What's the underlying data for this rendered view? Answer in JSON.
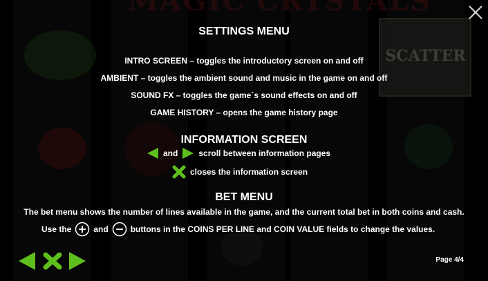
{
  "background": {
    "title_text": "MAGIC CRYSTALS",
    "scatter_text": "SCATTER"
  },
  "settings": {
    "heading": "SETTINGS MENU",
    "items": [
      "INTRO SCREEN – toggles the introductory screen on and off",
      "AMBIENT – toggles the ambient sound and music in the game on and off",
      "SOUND FX – toggles the game`s sound effects on and off",
      "GAME HISTORY – opens the game history page"
    ]
  },
  "information": {
    "heading": "INFORMATION SCREEN",
    "arrows_and": "and",
    "arrows_text": "scroll between information pages",
    "close_text": "closes the information screen"
  },
  "bet": {
    "heading": "BET MENU",
    "description": "The bet menu shows the number of lines available in the game, and the current total bet in both coins and cash.",
    "use_the": "Use the",
    "and": "and",
    "buttons_text": "buttons in the COINS PER LINE and COIN VALUE fields to change the values."
  },
  "page_indicator": "Page 4/4",
  "colors": {
    "accent_green": "#5fbf1e",
    "background": "#000000",
    "text": "#ffffff"
  },
  "icons": {
    "close": "close-icon",
    "prev": "arrow-left-icon",
    "next": "arrow-right-icon",
    "close_info": "x-icon",
    "plus": "plus-circle-icon",
    "minus": "minus-circle-icon"
  }
}
